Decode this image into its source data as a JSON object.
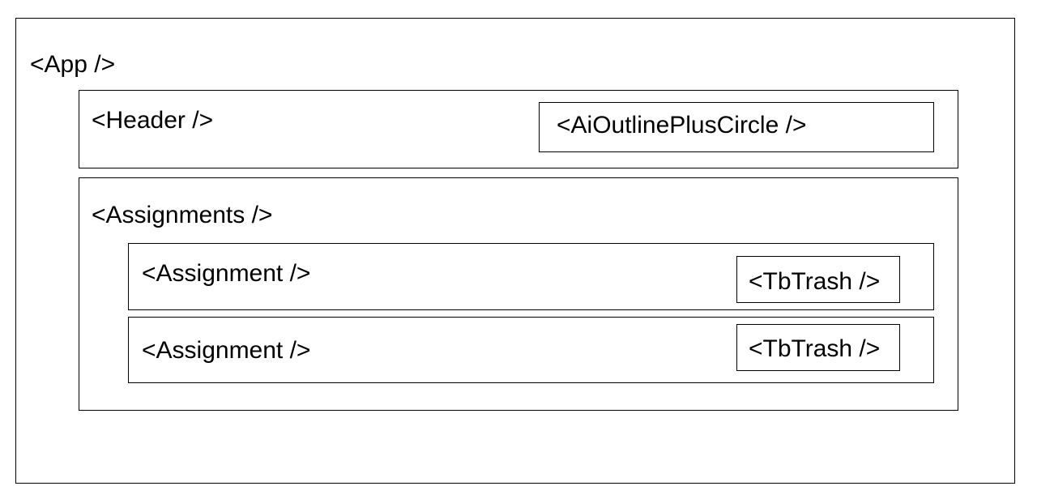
{
  "diagram": {
    "app": {
      "label": "<App />"
    },
    "header": {
      "label": "<Header />",
      "add_button": {
        "label": "<AiOutlinePlusCircle />"
      }
    },
    "assignments": {
      "label": "<Assignments />",
      "items": [
        {
          "label": "<Assignment />",
          "delete_button": {
            "label": "<TbTrash />"
          }
        },
        {
          "label": "<Assignment />",
          "delete_button": {
            "label": "<TbTrash />"
          }
        }
      ]
    }
  }
}
